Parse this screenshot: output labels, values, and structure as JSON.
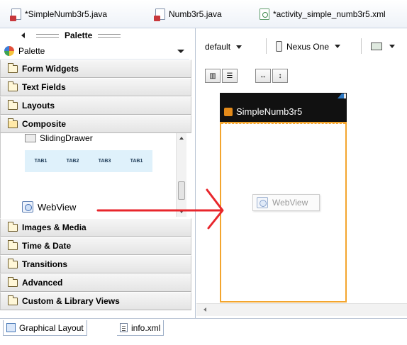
{
  "editor_tabs": [
    {
      "label": "*SimpleNumb3r5.java",
      "icon": "java-file-icon"
    },
    {
      "label": "Numb3r5.java",
      "icon": "java-file-icon"
    },
    {
      "label": "*activity_simple_numb3r5.xml",
      "icon": "xml-layout-file-icon"
    }
  ],
  "palette": {
    "header": "Palette",
    "selector_value": "Palette",
    "categories_top": [
      "Form Widgets",
      "Text Fields",
      "Layouts"
    ],
    "open_category": "Composite",
    "composite_items": {
      "sliding_drawer": "SlidingDrawer",
      "tab_labels": [
        "TAB1",
        "TAB2",
        "TAB3",
        "TAB1"
      ],
      "webview": "WebView"
    },
    "categories_bottom": [
      "Images & Media",
      "Time & Date",
      "Transitions",
      "Advanced",
      "Custom & Library Views"
    ]
  },
  "toolbar": {
    "theme_value": "default",
    "device_value": "Nexus One"
  },
  "device_preview": {
    "app_title": "SimpleNumb3r5",
    "dropped_widget": "WebView",
    "accent_color": "#f3a52e"
  },
  "annotation": {
    "arrow_color": "#e8262c"
  },
  "bottom_tabs": [
    "Graphical Layout",
    "info.xml"
  ]
}
